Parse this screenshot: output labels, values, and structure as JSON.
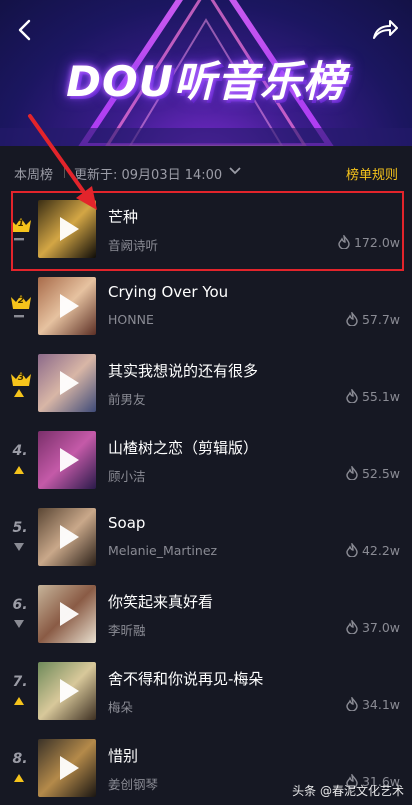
{
  "header": {
    "title": "DOU听音乐榜",
    "back_icon": "back-arrow-icon",
    "share_icon": "share-icon"
  },
  "subbar": {
    "week_label": "本周榜",
    "updated_label": "更新于: 09月03日 14:00",
    "rules_label": "榜单规则"
  },
  "colors": {
    "accent": "#f5c31b",
    "background": "#161823",
    "highlight": "#e3242b",
    "trend_up": "#f5c31b",
    "trend_flat": "#8a8b94"
  },
  "songs": [
    {
      "rank": "1",
      "crown": true,
      "trend": "flat",
      "title": "芒种",
      "artist": "音阙诗听",
      "heat": "172.0w"
    },
    {
      "rank": "2",
      "crown": true,
      "trend": "flat",
      "title": "Crying Over You",
      "artist": "HONNE",
      "heat": "57.7w"
    },
    {
      "rank": "3",
      "crown": true,
      "trend": "up",
      "title": "其实我想说的还有很多",
      "artist": "前男友",
      "heat": "55.1w"
    },
    {
      "rank": "4.",
      "crown": false,
      "trend": "up",
      "title": "山楂树之恋（剪辑版）",
      "artist": "顾小洁",
      "heat": "52.5w"
    },
    {
      "rank": "5.",
      "crown": false,
      "trend": "down",
      "title": "Soap",
      "artist": "Melanie_Martinez",
      "heat": "42.2w"
    },
    {
      "rank": "6.",
      "crown": false,
      "trend": "down",
      "title": "你笑起来真好看",
      "artist": "李昕融",
      "heat": "37.0w"
    },
    {
      "rank": "7.",
      "crown": false,
      "trend": "up",
      "title": "舍不得和你说再见-梅朵",
      "artist": "梅朵",
      "heat": "34.1w"
    },
    {
      "rank": "8.",
      "crown": false,
      "trend": "up",
      "title": "惜别",
      "artist": "姜创钢琴",
      "heat": "31.6w"
    }
  ],
  "watermark": "头条 @春泥文化艺术"
}
